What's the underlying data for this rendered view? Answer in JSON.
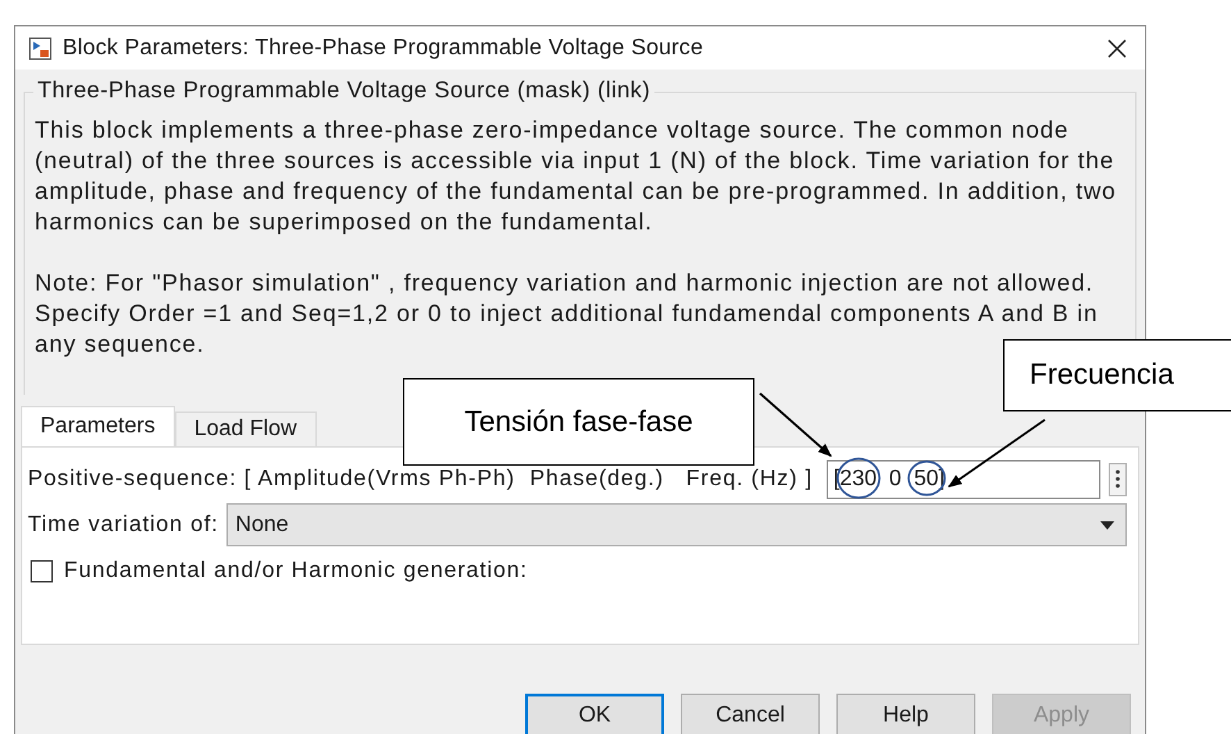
{
  "window": {
    "title": "Block Parameters: Three-Phase Programmable Voltage Source"
  },
  "group": {
    "title": "Three-Phase Programmable Voltage Source (mask) (link)",
    "paragraphs": [
      "This block implements a three-phase zero-impedance voltage source. The common node\n(neutral) of the three sources is accessible via input 1 (N) of the block. Time variation for the\namplitude, phase and frequency of the fundamental can be pre-programmed. In addition, two\nharmonics can be superimposed on the fundamental.",
      "Note: For  \"Phasor simulation\" , frequency variation and harmonic injection are not allowed.\nSpecify  Order =1 and Seq=1,2 or 0 to inject additional fundamendal components A and B in\nany sequence."
    ]
  },
  "tabs": [
    {
      "label": "Parameters",
      "selected": true
    },
    {
      "label": "Load Flow",
      "selected": false
    }
  ],
  "parameters": [
    {
      "kind": "edit",
      "label": "Positive-sequence: [ Amplitude(Vrms Ph-Ph)  Phase(deg.)   Freq. (Hz) ]",
      "value": "[230  0  50]"
    },
    {
      "kind": "dropdown",
      "label": "Time variation of:",
      "value": "None"
    },
    {
      "kind": "checkbox",
      "label": "Fundamental and/or Harmonic generation:",
      "checked": false
    }
  ],
  "buttons": [
    {
      "label": "OK",
      "default": true,
      "disabled": false
    },
    {
      "label": "Cancel",
      "default": false,
      "disabled": false
    },
    {
      "label": "Help",
      "default": false,
      "disabled": false
    },
    {
      "label": "Apply",
      "default": false,
      "disabled": true
    }
  ],
  "annotations": [
    {
      "text": "Tensión fase-fase"
    },
    {
      "text": "Frecuencia"
    }
  ]
}
